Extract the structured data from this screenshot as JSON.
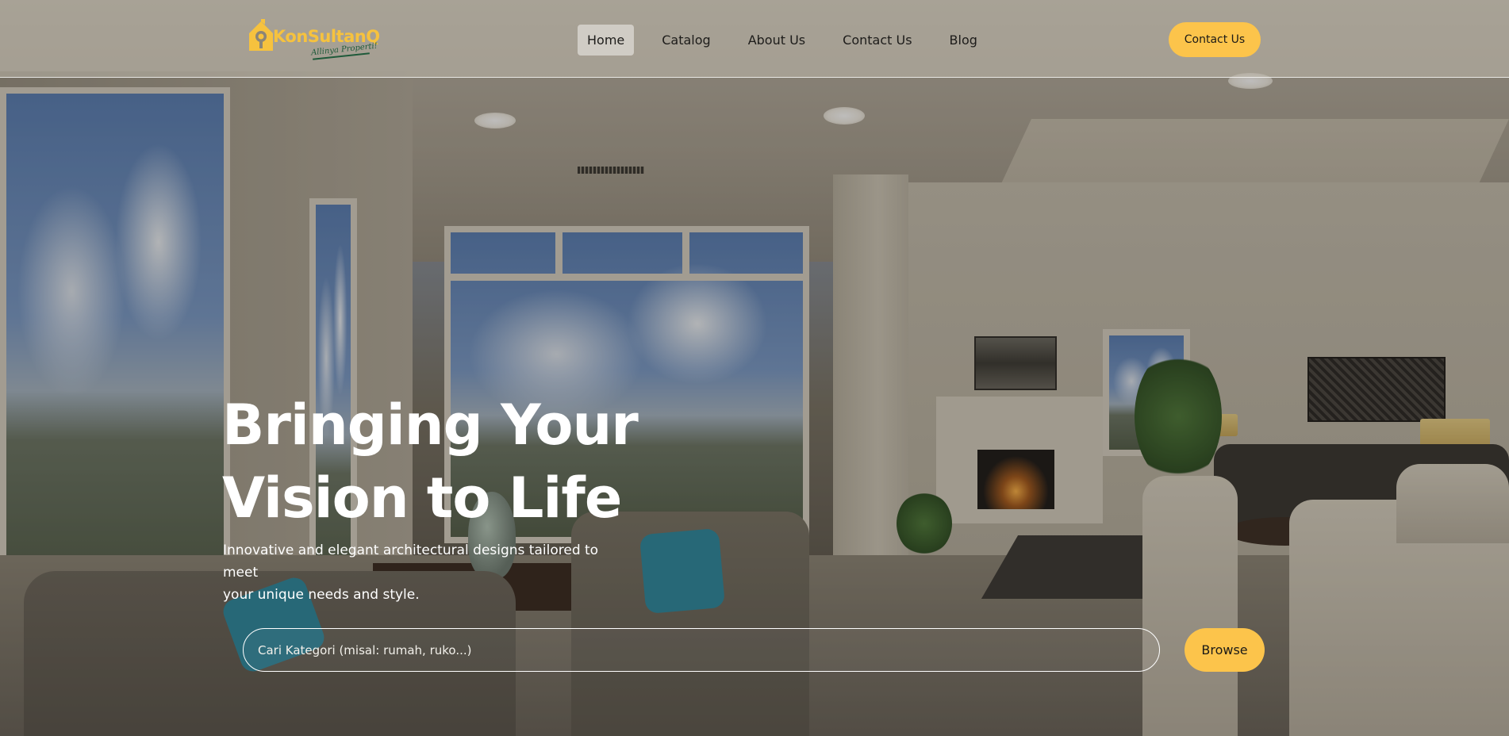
{
  "header": {
    "logo": {
      "name": "KonSultanQ",
      "tagline": "Allinya Properti!"
    },
    "nav": [
      {
        "label": "Home",
        "active": true
      },
      {
        "label": "Catalog",
        "active": false
      },
      {
        "label": "About Us",
        "active": false
      },
      {
        "label": "Contact Us",
        "active": false
      },
      {
        "label": "Blog",
        "active": false
      }
    ],
    "cta_label": "Contact Us"
  },
  "hero": {
    "title_line1": "Bringing Your",
    "title_line2": "Vision to Life",
    "subtitle_line1": "Innovative and elegant architectural designs tailored to meet",
    "subtitle_line2": "your unique needs and style.",
    "search": {
      "placeholder": "Cari Kategori (misal: rumah, ruko...)",
      "value": ""
    },
    "browse_label": "Browse"
  },
  "colors": {
    "accent": "#fcc44b",
    "logo_yellow": "#f6c23e",
    "logo_green": "#1f5a3a",
    "nav_text": "#1d1c1a",
    "hero_text": "#ffffff"
  },
  "icons": {
    "logo": "house-key-icon"
  }
}
